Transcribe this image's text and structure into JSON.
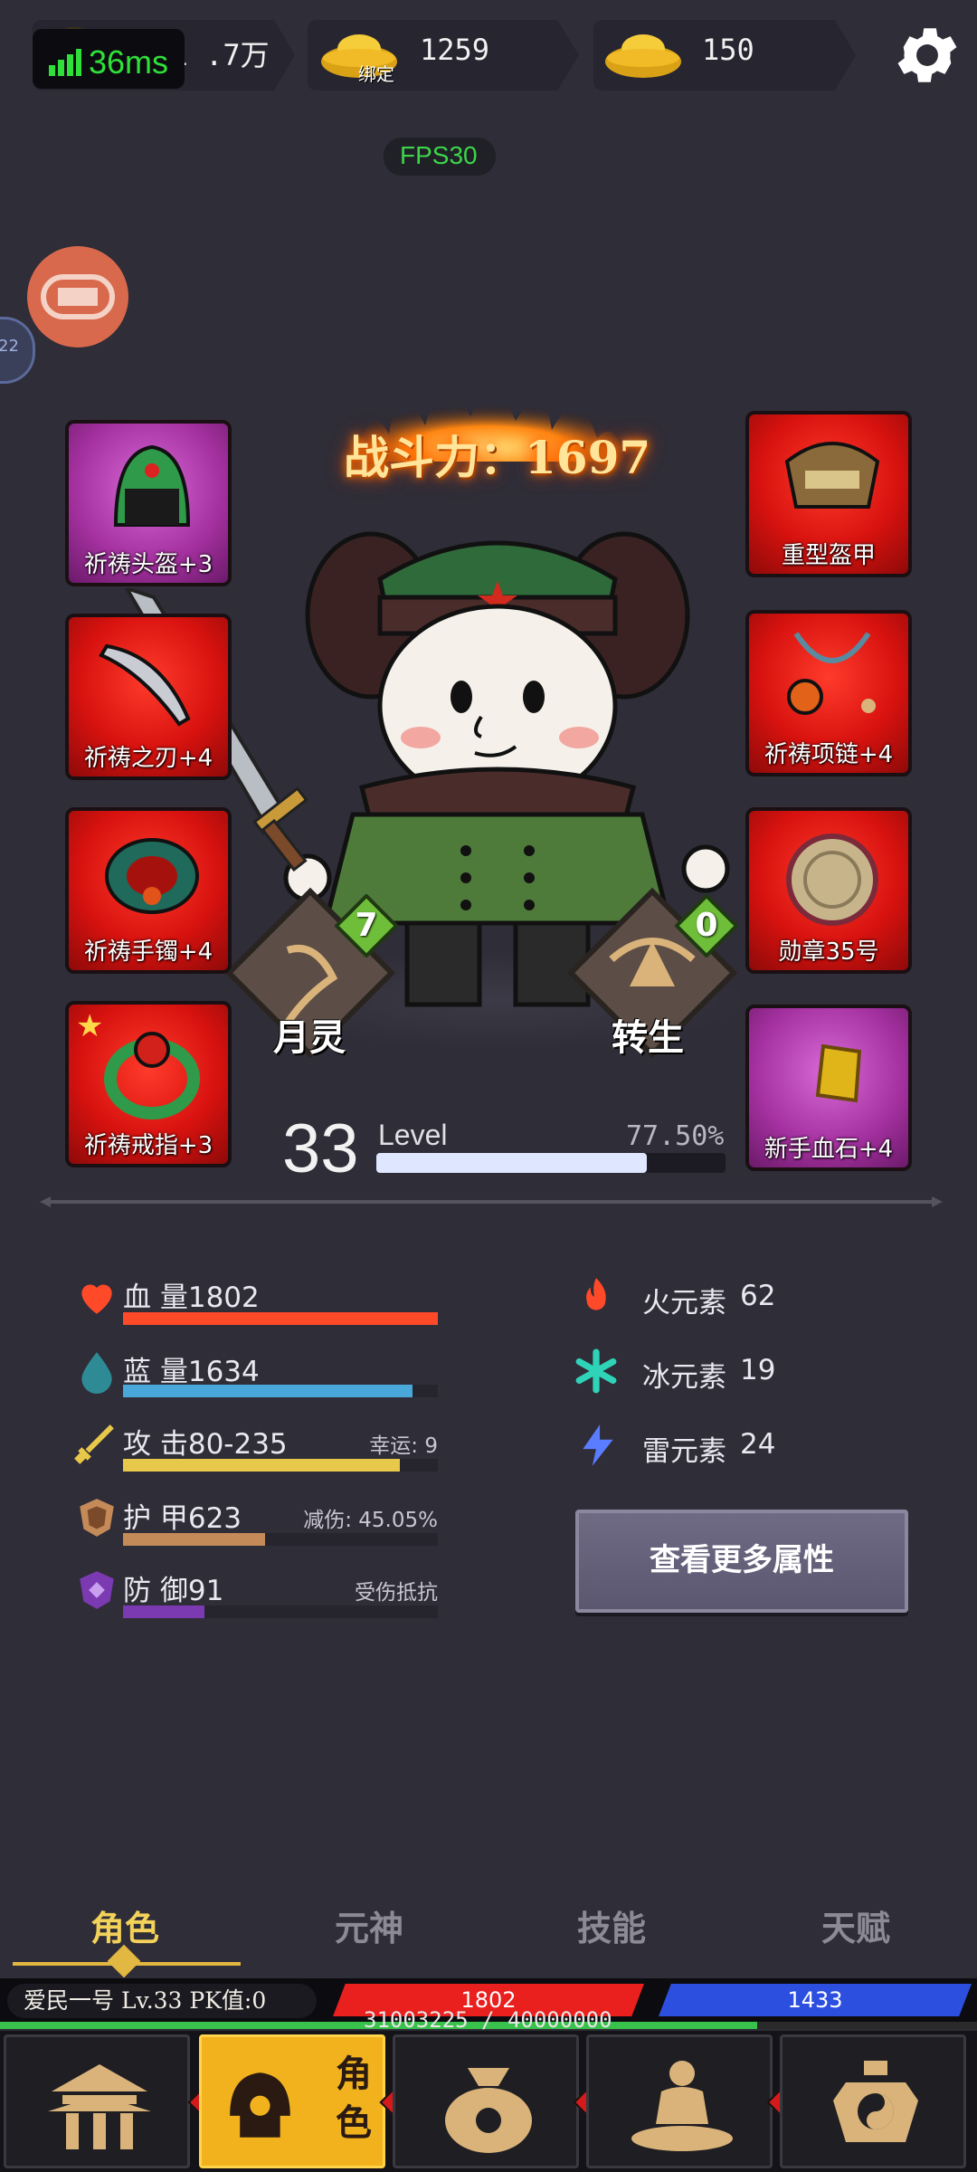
{
  "top_bar": {
    "gold": "951 .7万",
    "ping": "36ms",
    "bound_ingot": "1259",
    "bound_tag": "绑定",
    "ingot": "150",
    "fps": "FPS30",
    "side_badge": "22"
  },
  "character": {
    "combat_power": "战斗力：1697",
    "moon_spirit": {
      "label": "月灵",
      "count": "7"
    },
    "rebirth": {
      "label": "转生",
      "count": "0"
    }
  },
  "equipment": {
    "left": [
      {
        "label": "祈祷头盔+3",
        "rarity": "purple"
      },
      {
        "label": "祈祷之刃+4",
        "rarity": "red"
      },
      {
        "label": "祈祷手镯+4",
        "rarity": "red"
      },
      {
        "label": "祈祷戒指+3",
        "rarity": "red"
      }
    ],
    "right": [
      {
        "label": "重型盔甲",
        "rarity": "red"
      },
      {
        "label": "祈祷项链+4",
        "rarity": "red"
      },
      {
        "label": "勋章35号",
        "rarity": "red"
      },
      {
        "label": "新手血石+4",
        "rarity": "purple"
      }
    ]
  },
  "level": {
    "number": "33",
    "word": "Level",
    "percent_text": "77.50%",
    "progress": 0.775
  },
  "stats": {
    "hp": {
      "label": "血 量1802",
      "fill": 1.0,
      "color": "#ff4a2a"
    },
    "mp": {
      "label": "蓝 量1634",
      "fill": 0.92,
      "color": "#49a8d9"
    },
    "atk": {
      "label": "攻 击80-235",
      "note": "幸运: 9",
      "fill": 0.88,
      "color": "#e8c84a"
    },
    "armor": {
      "label": "护 甲623",
      "note": "减伤: 45.05%",
      "fill": 0.45,
      "color": "#c48a58"
    },
    "defense": {
      "label": "防 御91",
      "note": "受伤抵抗",
      "fill": 0.26,
      "color": "#7b3ab2"
    }
  },
  "elements": [
    {
      "label": "火元素",
      "value": "62",
      "color": "#ff4a2a"
    },
    {
      "label": "冰元素",
      "value": "19",
      "color": "#2ed3b8"
    },
    {
      "label": "雷元素",
      "value": "24",
      "color": "#5a7cff"
    }
  ],
  "more_button": "查看更多属性",
  "tabs": [
    "角色",
    "元神",
    "技能",
    "天赋"
  ],
  "status": {
    "name_line": "爱民一号   Lv.33 PK值:0",
    "hp": "1802",
    "mp": "1433",
    "exp_text": "31003225 / 40000000",
    "exp_progress": 0.775
  },
  "nav": {
    "active_label": "角色"
  },
  "colors": {
    "accent": "#f2b21e",
    "background": "#2f2d37"
  }
}
